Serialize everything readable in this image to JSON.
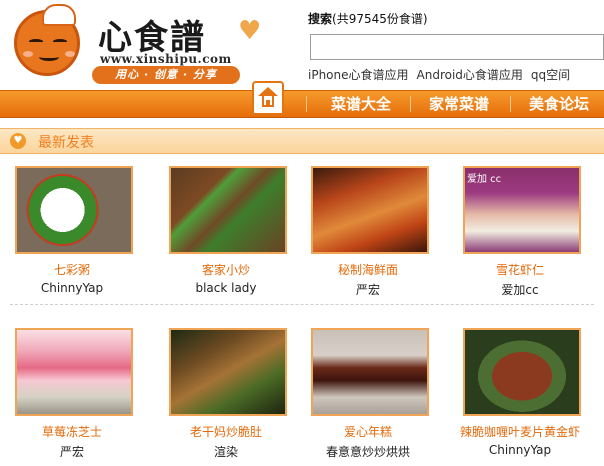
{
  "logo": {
    "brand": "心食譜",
    "url": "www.xinshipu.com",
    "slogan": "用心 · 创意 · 分享"
  },
  "search": {
    "label_bold": "搜索",
    "label_rest": "(共97545份食谱)",
    "placeholder": "",
    "value": ""
  },
  "app_links": [
    "iPhone心食谱应用",
    "Android心食谱应用",
    "qq空间"
  ],
  "nav": {
    "items": [
      "菜谱大全",
      "家常菜谱",
      "美食论坛"
    ]
  },
  "section": {
    "title": "最新发表"
  },
  "recipes": [
    {
      "title": "七彩粥",
      "author": "ChinnyYap",
      "thumb": "t1",
      "overlay": ""
    },
    {
      "title": "客家小炒",
      "author": "black lady",
      "thumb": "t2",
      "overlay": ""
    },
    {
      "title": "秘制海鲜面",
      "author": "严宏",
      "thumb": "t3",
      "overlay": ""
    },
    {
      "title": "雪花虾仁",
      "author": "爱加cc",
      "thumb": "t4",
      "overlay": "爱加 cc"
    },
    {
      "title": "草莓冻芝士",
      "author": "严宏",
      "thumb": "t5",
      "overlay": ""
    },
    {
      "title": "老干妈炒脆肚",
      "author": "渲染",
      "thumb": "t6",
      "overlay": ""
    },
    {
      "title": "爱心年糕",
      "author": "春意意炒炒烘烘",
      "thumb": "t7",
      "overlay": ""
    },
    {
      "title": "辣脆咖喱叶麦片黄金虾",
      "author": "ChinnyYap",
      "thumb": "t8",
      "overlay": ""
    }
  ],
  "colors": {
    "accent": "#e66d0a",
    "title_text": "#e36a0b"
  }
}
